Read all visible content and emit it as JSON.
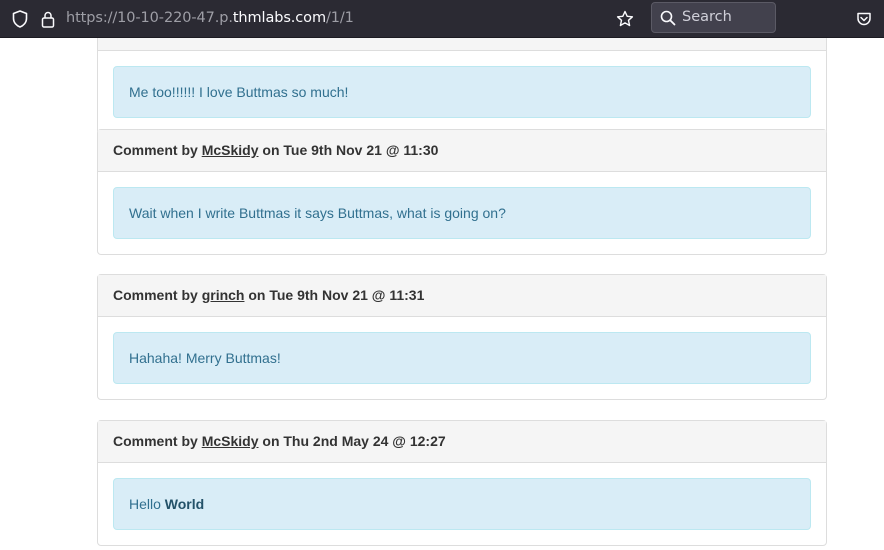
{
  "browser": {
    "url_prefix": "https://10-10-220-47.p.",
    "url_host": "thmlabs.com",
    "url_suffix": "/1/1",
    "search_placeholder": "Search",
    "icons": [
      "shield-icon",
      "lock-icon",
      "star-icon",
      "search-icon",
      "pocket-icon"
    ]
  },
  "comments": [
    {
      "heading_prefix": "",
      "author": "",
      "heading_suffix": "",
      "body": "Me too!!!!!! I love Buttmas so much!"
    },
    {
      "heading_prefix": "Comment by",
      "author": "McSkidy",
      "heading_suffix": "on Tue 9th Nov 21 @ 11:30",
      "body": "Wait when I write Buttmas it says Buttmas, what is going on?"
    },
    {
      "heading_prefix": "Comment by",
      "author": "grinch",
      "heading_suffix": "on Tue 9th Nov 21 @ 11:31",
      "body": "Hahaha! Merry Buttmas!"
    },
    {
      "heading_prefix": "Comment by",
      "author": "McSkidy",
      "heading_suffix": "on Thu 2nd May 24 @ 12:27",
      "body_plain": "Hello",
      "body_bold": "World"
    }
  ],
  "colors": {
    "toolbar_bg": "#2b2a33",
    "alert_bg": "#d9edf7",
    "alert_text": "#31708f",
    "heading_bg": "#f5f5f5"
  }
}
